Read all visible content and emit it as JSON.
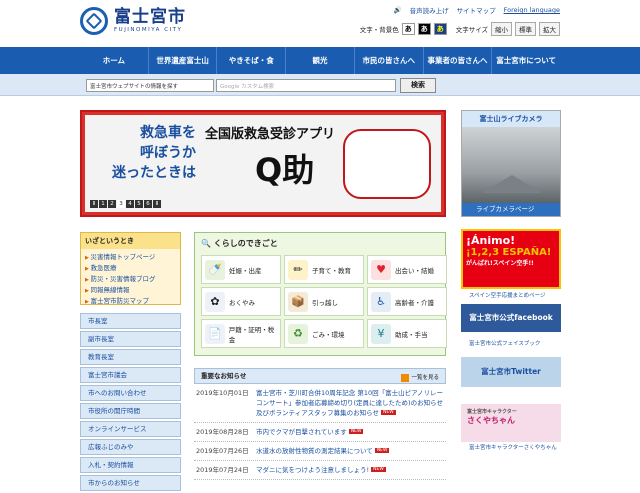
{
  "header": {
    "logo_jp": "富士宮市",
    "logo_en": "FUJINOMIYA CITY",
    "read_aloud": "音声読み上げ",
    "sitemap": "サイトマップ",
    "foreign": "Foreign language",
    "text_bg_label": "文字・背景色",
    "bg_options": [
      "あ",
      "あ",
      "あ"
    ],
    "text_size_label": "文字サイズ",
    "size_small": "縮小",
    "size_std": "標準",
    "size_big": "拡大"
  },
  "nav": [
    "ホーム",
    "世界遺産富士山",
    "やきそば・食",
    "観光",
    "市民の皆さんへ",
    "事業者の皆さんへ",
    "富士宮市について"
  ],
  "search": {
    "select": "富士宮市ウェブサイトの情報を探す",
    "placeholder": "Google カスタム検索",
    "button": "検索"
  },
  "banner": {
    "left": [
      "救急車を",
      "呼ぼうか",
      "迷ったときは"
    ],
    "right": "全国版救急受診アプリ",
    "q": "Q助",
    "pages": [
      "Ⅱ",
      "1",
      "2",
      "3",
      "4",
      "5",
      "6",
      "Ⅱ"
    ],
    "current_page": "3"
  },
  "camera": {
    "title": "富士山ライブカメラ",
    "link": "ライブカメラページ"
  },
  "emergency": {
    "title": "いざというとき",
    "items": [
      "災害情報トップページ",
      "救急医療",
      "防災・災害情報ブログ",
      "同報無線情報",
      "富士宮市防災マップ"
    ]
  },
  "sidebar": [
    "市長室",
    "副市長室",
    "教育長室",
    "富士宮市議会",
    "市へのお問い合わせ",
    "市役所の開庁時間",
    "オンラインサービス",
    "広報ふじのみや",
    "入札・契約情報",
    "市からのお知らせ"
  ],
  "life": {
    "title": "くらしのできごと",
    "cells": [
      {
        "label": "妊娠・出産",
        "icon": "🍼"
      },
      {
        "label": "子育て・教育",
        "icon": "✏"
      },
      {
        "label": "出会い・結婚",
        "icon": "♥"
      },
      {
        "label": "おくやみ",
        "icon": "✿"
      },
      {
        "label": "引っ越し",
        "icon": "📦"
      },
      {
        "label": "高齢者・介護",
        "icon": "♿"
      },
      {
        "label": "戸籍・証明・税金",
        "icon": "📄"
      },
      {
        "label": "ごみ・環境",
        "icon": "♻"
      },
      {
        "label": "助成・手当",
        "icon": "¥"
      }
    ]
  },
  "news": {
    "title": "重要なお知らせ",
    "rss": "一覧を見る",
    "new_label": "NEW",
    "items": [
      {
        "date": "2019年10月01日",
        "text": "富士宮市・芝川町合併10周年記念 第10回「富士山ピアノリレーコンサート」参加者応募締め切り(定員に達したため)のお知らせ及びボランティアスタッフ募集のお知らせ"
      },
      {
        "date": "2019年08月28日",
        "text": "市内でクマが目撃されています"
      },
      {
        "date": "2019年07月26日",
        "text": "水道水の放射性物質の測定結果について"
      },
      {
        "date": "2019年07月24日",
        "text": "マダニに気をつけよう注意しましょう!"
      }
    ]
  },
  "right": {
    "animo_title": "¡Ánimo!",
    "animo_sub": "¡1,2,3 ESPAÑA!",
    "animo_note": "がんばれ!スペイン空手!!",
    "animo_link": "スペイン空手応援まとめページ",
    "fb": "富士宮市公式facebook",
    "fb_link": "富士宮市公式フェイスブック",
    "tw": "富士宮市Twitter",
    "saku_small": "富士宮市キャラクター",
    "saku": "さくやちゃん",
    "saku_link": "富士宮市キャラクターさくやちゃん"
  },
  "colors": {
    "nav": "#1a5cb0",
    "banner": "#d9302c",
    "accent": "#e06000"
  }
}
